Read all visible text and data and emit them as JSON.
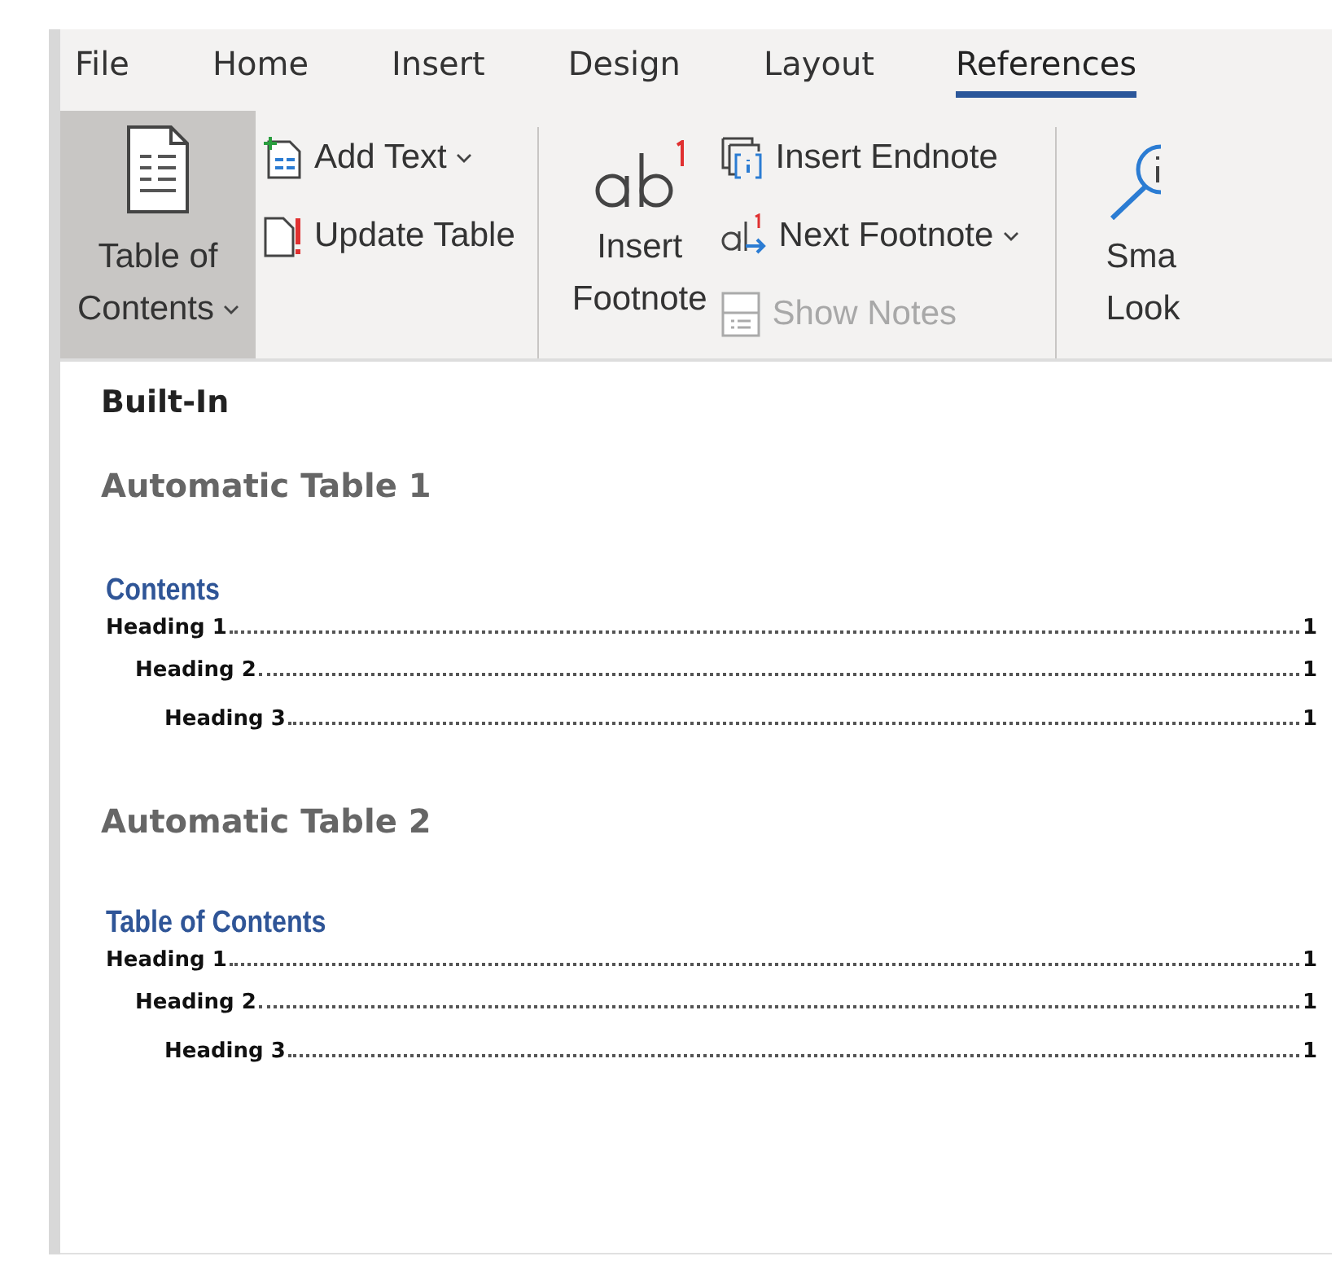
{
  "tabs": [
    {
      "label": "File",
      "selected": false
    },
    {
      "label": "Home",
      "selected": false
    },
    {
      "label": "Insert",
      "selected": false
    },
    {
      "label": "Design",
      "selected": false
    },
    {
      "label": "Layout",
      "selected": false
    },
    {
      "label": "References",
      "selected": true
    }
  ],
  "ribbon": {
    "groups": [
      {
        "big_button": {
          "kind": "toc",
          "lines": [
            "Table of",
            "Contents"
          ],
          "dropdown": true,
          "selected": true
        },
        "small_buttons": [
          {
            "kind": "add-text",
            "label": "Add Text",
            "dropdown": true,
            "disabled": false
          },
          {
            "kind": "update-table",
            "label": "Update Table",
            "dropdown": false,
            "disabled": false
          }
        ]
      },
      {
        "big_button": {
          "kind": "footnote",
          "lines": [
            "Insert",
            "Footnote"
          ],
          "dropdown": false,
          "selected": false
        },
        "small_buttons": [
          {
            "kind": "endnote",
            "label": "Insert Endnote",
            "dropdown": false,
            "disabled": false
          },
          {
            "kind": "next-footnote",
            "label": "Next Footnote",
            "dropdown": true,
            "disabled": false
          },
          {
            "kind": "show-notes",
            "label": "Show Notes",
            "dropdown": false,
            "disabled": true
          }
        ]
      },
      {
        "big_button": {
          "kind": "smart-lookup",
          "lines": [
            "Sma",
            "Look"
          ],
          "dropdown": false,
          "selected": false
        }
      }
    ]
  },
  "gallery": {
    "section_label": "Built-In",
    "styles": [
      {
        "name": "Automatic Table 1",
        "toc_title": "Contents",
        "entries": [
          {
            "text": "Heading 1",
            "page": "1",
            "children": [
              {
                "text": "Heading 2",
                "page": "1",
                "children": [
                  {
                    "text": "Heading 3",
                    "page": "1"
                  }
                ]
              }
            ]
          }
        ]
      },
      {
        "name": "Automatic Table 2",
        "toc_title": "Table of Contents",
        "entries": [
          {
            "text": "Heading 1",
            "page": "1",
            "children": [
              {
                "text": "Heading 2",
                "page": "1",
                "children": [
                  {
                    "text": "Heading 3",
                    "page": "1"
                  }
                ]
              }
            ]
          }
        ]
      }
    ]
  }
}
